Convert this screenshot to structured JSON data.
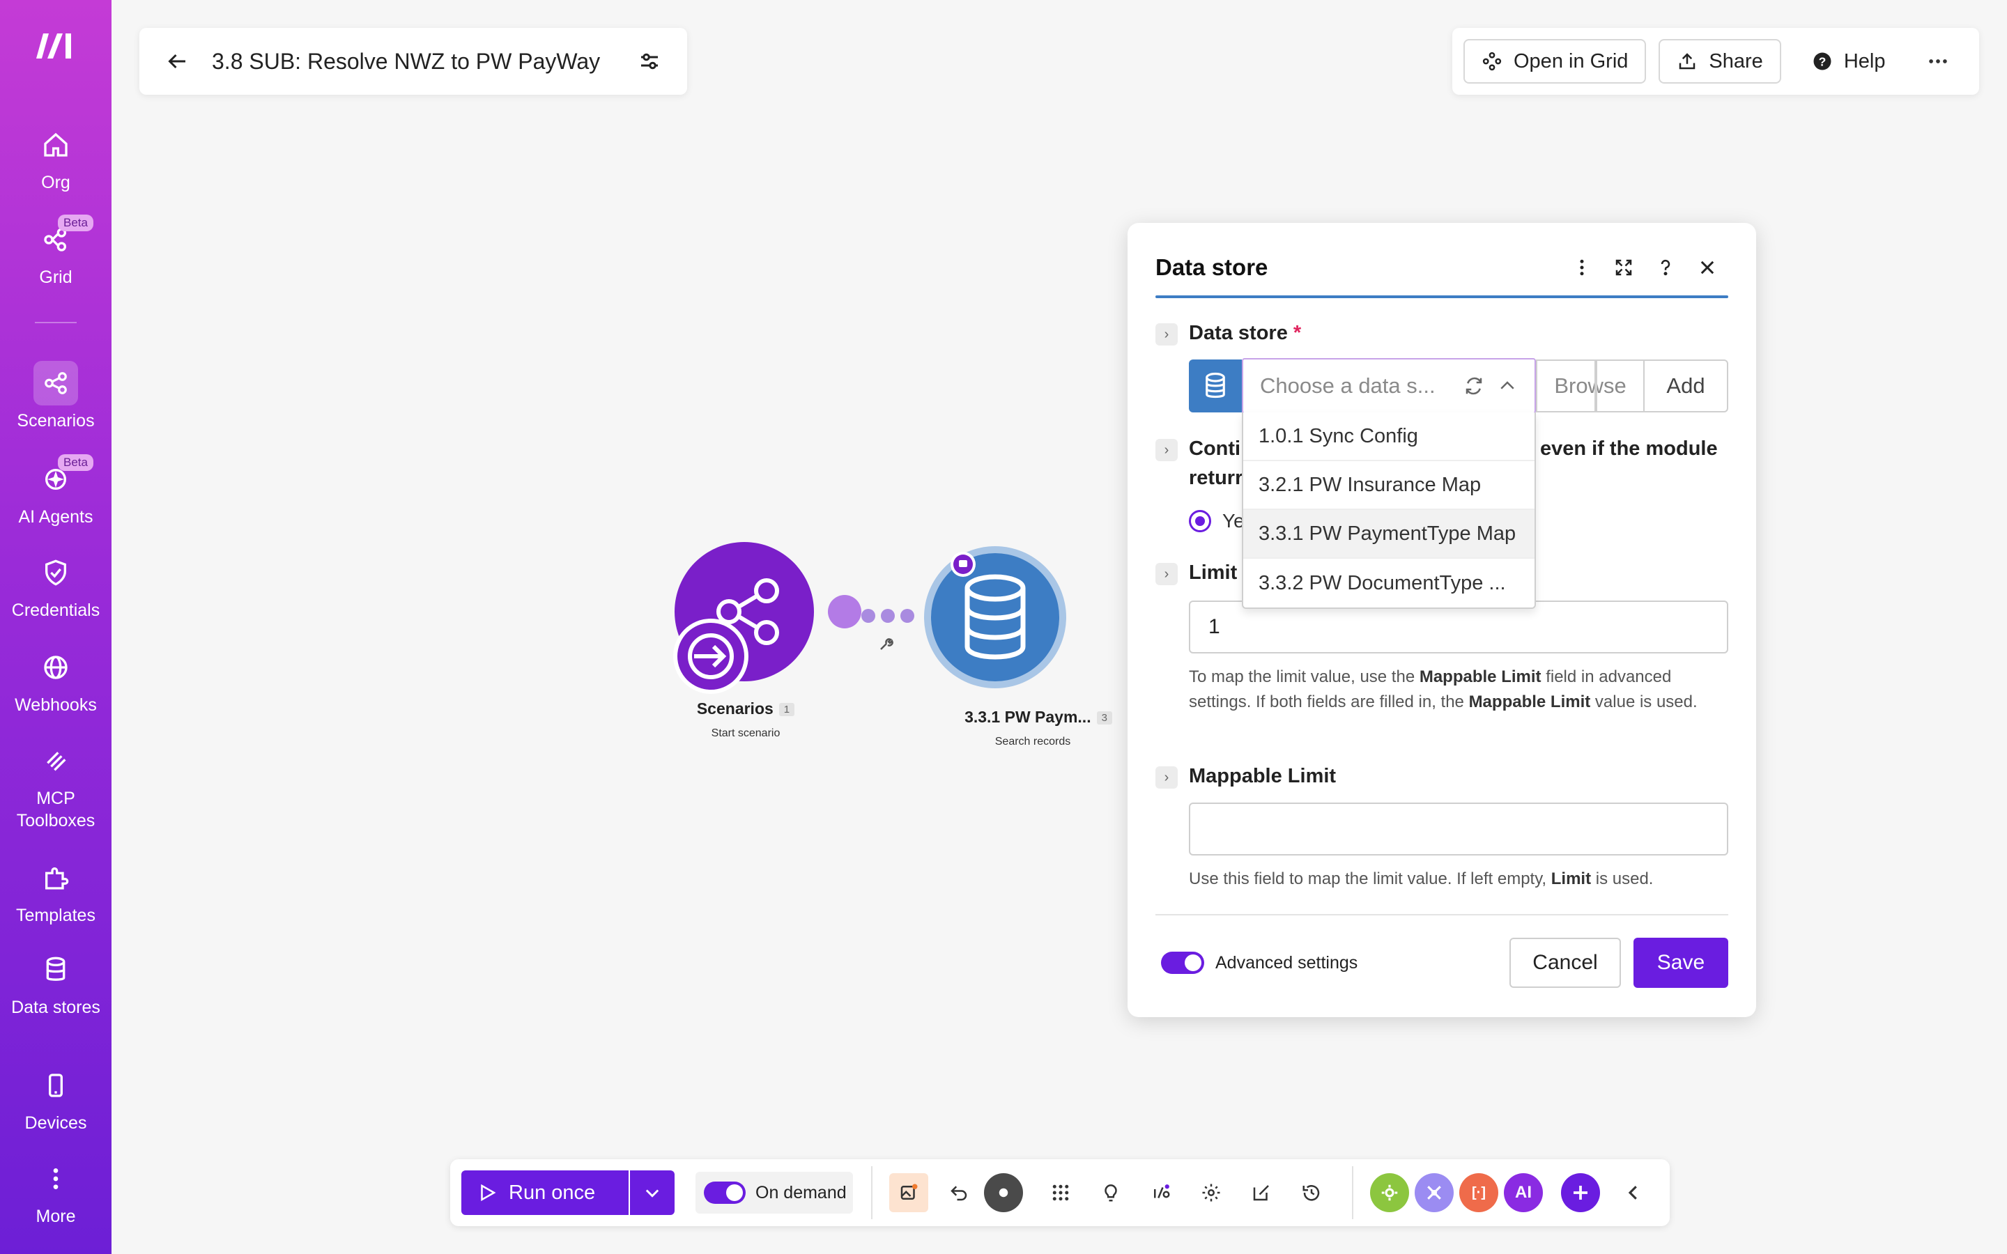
{
  "sidebar": {
    "items": [
      {
        "label": "Org",
        "icon": "home-icon"
      },
      {
        "label": "Grid",
        "icon": "grid-icon",
        "badge": "Beta"
      },
      {
        "label": "Scenarios",
        "icon": "scenarios-icon",
        "active": true
      },
      {
        "label": "AI Agents",
        "icon": "ai-agents-icon",
        "badge": "Beta"
      },
      {
        "label": "Credentials",
        "icon": "shield-icon"
      },
      {
        "label": "Webhooks",
        "icon": "globe-icon"
      },
      {
        "label": "MCP Toolboxes",
        "icon": "toolbox-icon"
      },
      {
        "label": "Templates",
        "icon": "puzzle-icon"
      },
      {
        "label": "Data stores",
        "icon": "database-icon"
      },
      {
        "label": "Devices",
        "icon": "device-icon"
      },
      {
        "label": "More",
        "icon": "more-vertical-icon"
      }
    ]
  },
  "header": {
    "scenario_title": "3.8 SUB: Resolve NWZ to PW PayWay",
    "open_in_grid": "Open in Grid",
    "share": "Share",
    "help": "Help"
  },
  "canvas": {
    "node1": {
      "label": "Scenarios",
      "count": "1",
      "sub": "Start scenario"
    },
    "node2": {
      "label": "3.3.1 PW Paym...",
      "count": "3",
      "sub": "Search records"
    }
  },
  "dialog": {
    "title": "Data store",
    "data_store_label": "Data store",
    "required_mark": "*",
    "select_placeholder": "Choose a data s...",
    "browse": "Browse",
    "add": "Add",
    "dropdown_options": [
      "1.0.1 Sync Config",
      "3.2.1 PW Insurance Map",
      "3.3.1 PW PaymentType Map",
      "3.3.2 PW DocumentType ..."
    ],
    "highlighted_option": 2,
    "continue_label_part1": "Conti",
    "continue_label_part2": "even if the module",
    "continue_label_line2": "returr",
    "radio_text": "Ye",
    "limit_label": "Limit",
    "limit_value": "1",
    "limit_hint_1": "To map the limit value, use the ",
    "limit_hint_b1": "Mappable Limit",
    "limit_hint_2": " field in advanced settings. If both fields are filled in, the ",
    "limit_hint_b2": "Mappable Limit",
    "limit_hint_3": " value is used.",
    "mappable_label": "Mappable Limit",
    "mappable_value": "",
    "mappable_hint_1": "Use this field to map the limit value. If left empty, ",
    "mappable_hint_b": "Limit",
    "mappable_hint_2": " is used.",
    "advanced_settings": "Advanced settings",
    "advanced_on": true,
    "cancel": "Cancel",
    "save": "Save"
  },
  "toolbar": {
    "run_once": "Run once",
    "on_demand": "On demand",
    "apps": [
      {
        "icon": "gear-app-icon",
        "color": "#8cc63f"
      },
      {
        "icon": "tools-app-icon",
        "color": "#9b8cf2"
      },
      {
        "icon": "bracket-app-icon",
        "text": "[·]",
        "color": "#ef6b4a"
      },
      {
        "icon": "ai-app-icon",
        "text": "AI",
        "color": "#8a2be2"
      }
    ]
  },
  "colors": {
    "accent": "#6a1de0",
    "datastore_blue": "#3d7dc4",
    "scenario_purple": "#7a1fc9"
  }
}
